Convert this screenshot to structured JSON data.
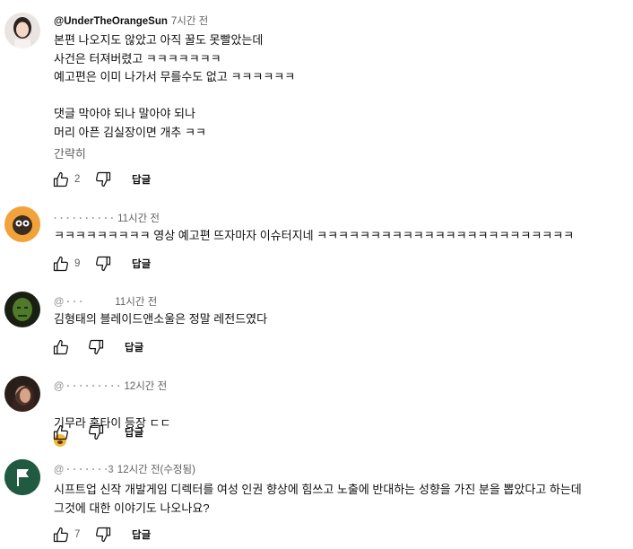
{
  "comments": [
    {
      "author": "@UnderTheOrangeSun",
      "time": "7시간 전",
      "text": "본편 나오지도 않았고 아직 꿀도 못빨았는데\n사건은 터져버렸고 ㅋㅋㅋㅋㅋㅋㅋ\n예고편은 이미 나가서 무를수도 없고 ㅋㅋㅋㅋㅋㅋ\n\n댓글 막아야 되나 말아야 되나\n머리 아픈 김실장이면 개추 ㅋㅋ",
      "more": "간략히",
      "likes": "2",
      "reply": "답글"
    },
    {
      "author": "·  · · · · · · · ·  ·",
      "time": "11시간 전",
      "text": "ㅋㅋㅋㅋㅋㅋㅋㅋㅋ 영상 예고편 뜨자마자 이슈터지네 ㅋㅋㅋㅋㅋㅋㅋㅋㅋㅋㅋㅋㅋㅋㅋㅋㅋㅋㅋㅋㅋㅋㅋㅋ",
      "likes": "9",
      "reply": "답글"
    },
    {
      "author": "@ · · ·",
      "time": "11시간 전",
      "text": "김형태의 블레이드앤소울은 정말 레전드였다",
      "likes": "",
      "reply": "답글"
    },
    {
      "author": "@ · · · · · · · · ·",
      "time": "12시간 전",
      "text": "기무라 혼타이 등장 ㄷㄷ",
      "likes": "",
      "reply": "답글"
    },
    {
      "author": "@ · · · · · · ·3",
      "time": "12시간 전(수정됨)",
      "text": "시프트업 신작 개발게임 디렉터를 여성 인권 향상에 힘쓰고 노출에 반대하는 성향을 가진 분을 뽑았다고 하는데\n그것에 대한 이야기도 나오나요?",
      "likes": "7",
      "reply": "답글"
    }
  ],
  "icons": {
    "like": "thumbs-up-icon",
    "dislike": "thumbs-down-icon",
    "emoji": "face-screaming-emoji"
  },
  "colors": {
    "text": "#0f0f0f",
    "secondary": "#606060",
    "avatar5": "#1f5a41"
  }
}
